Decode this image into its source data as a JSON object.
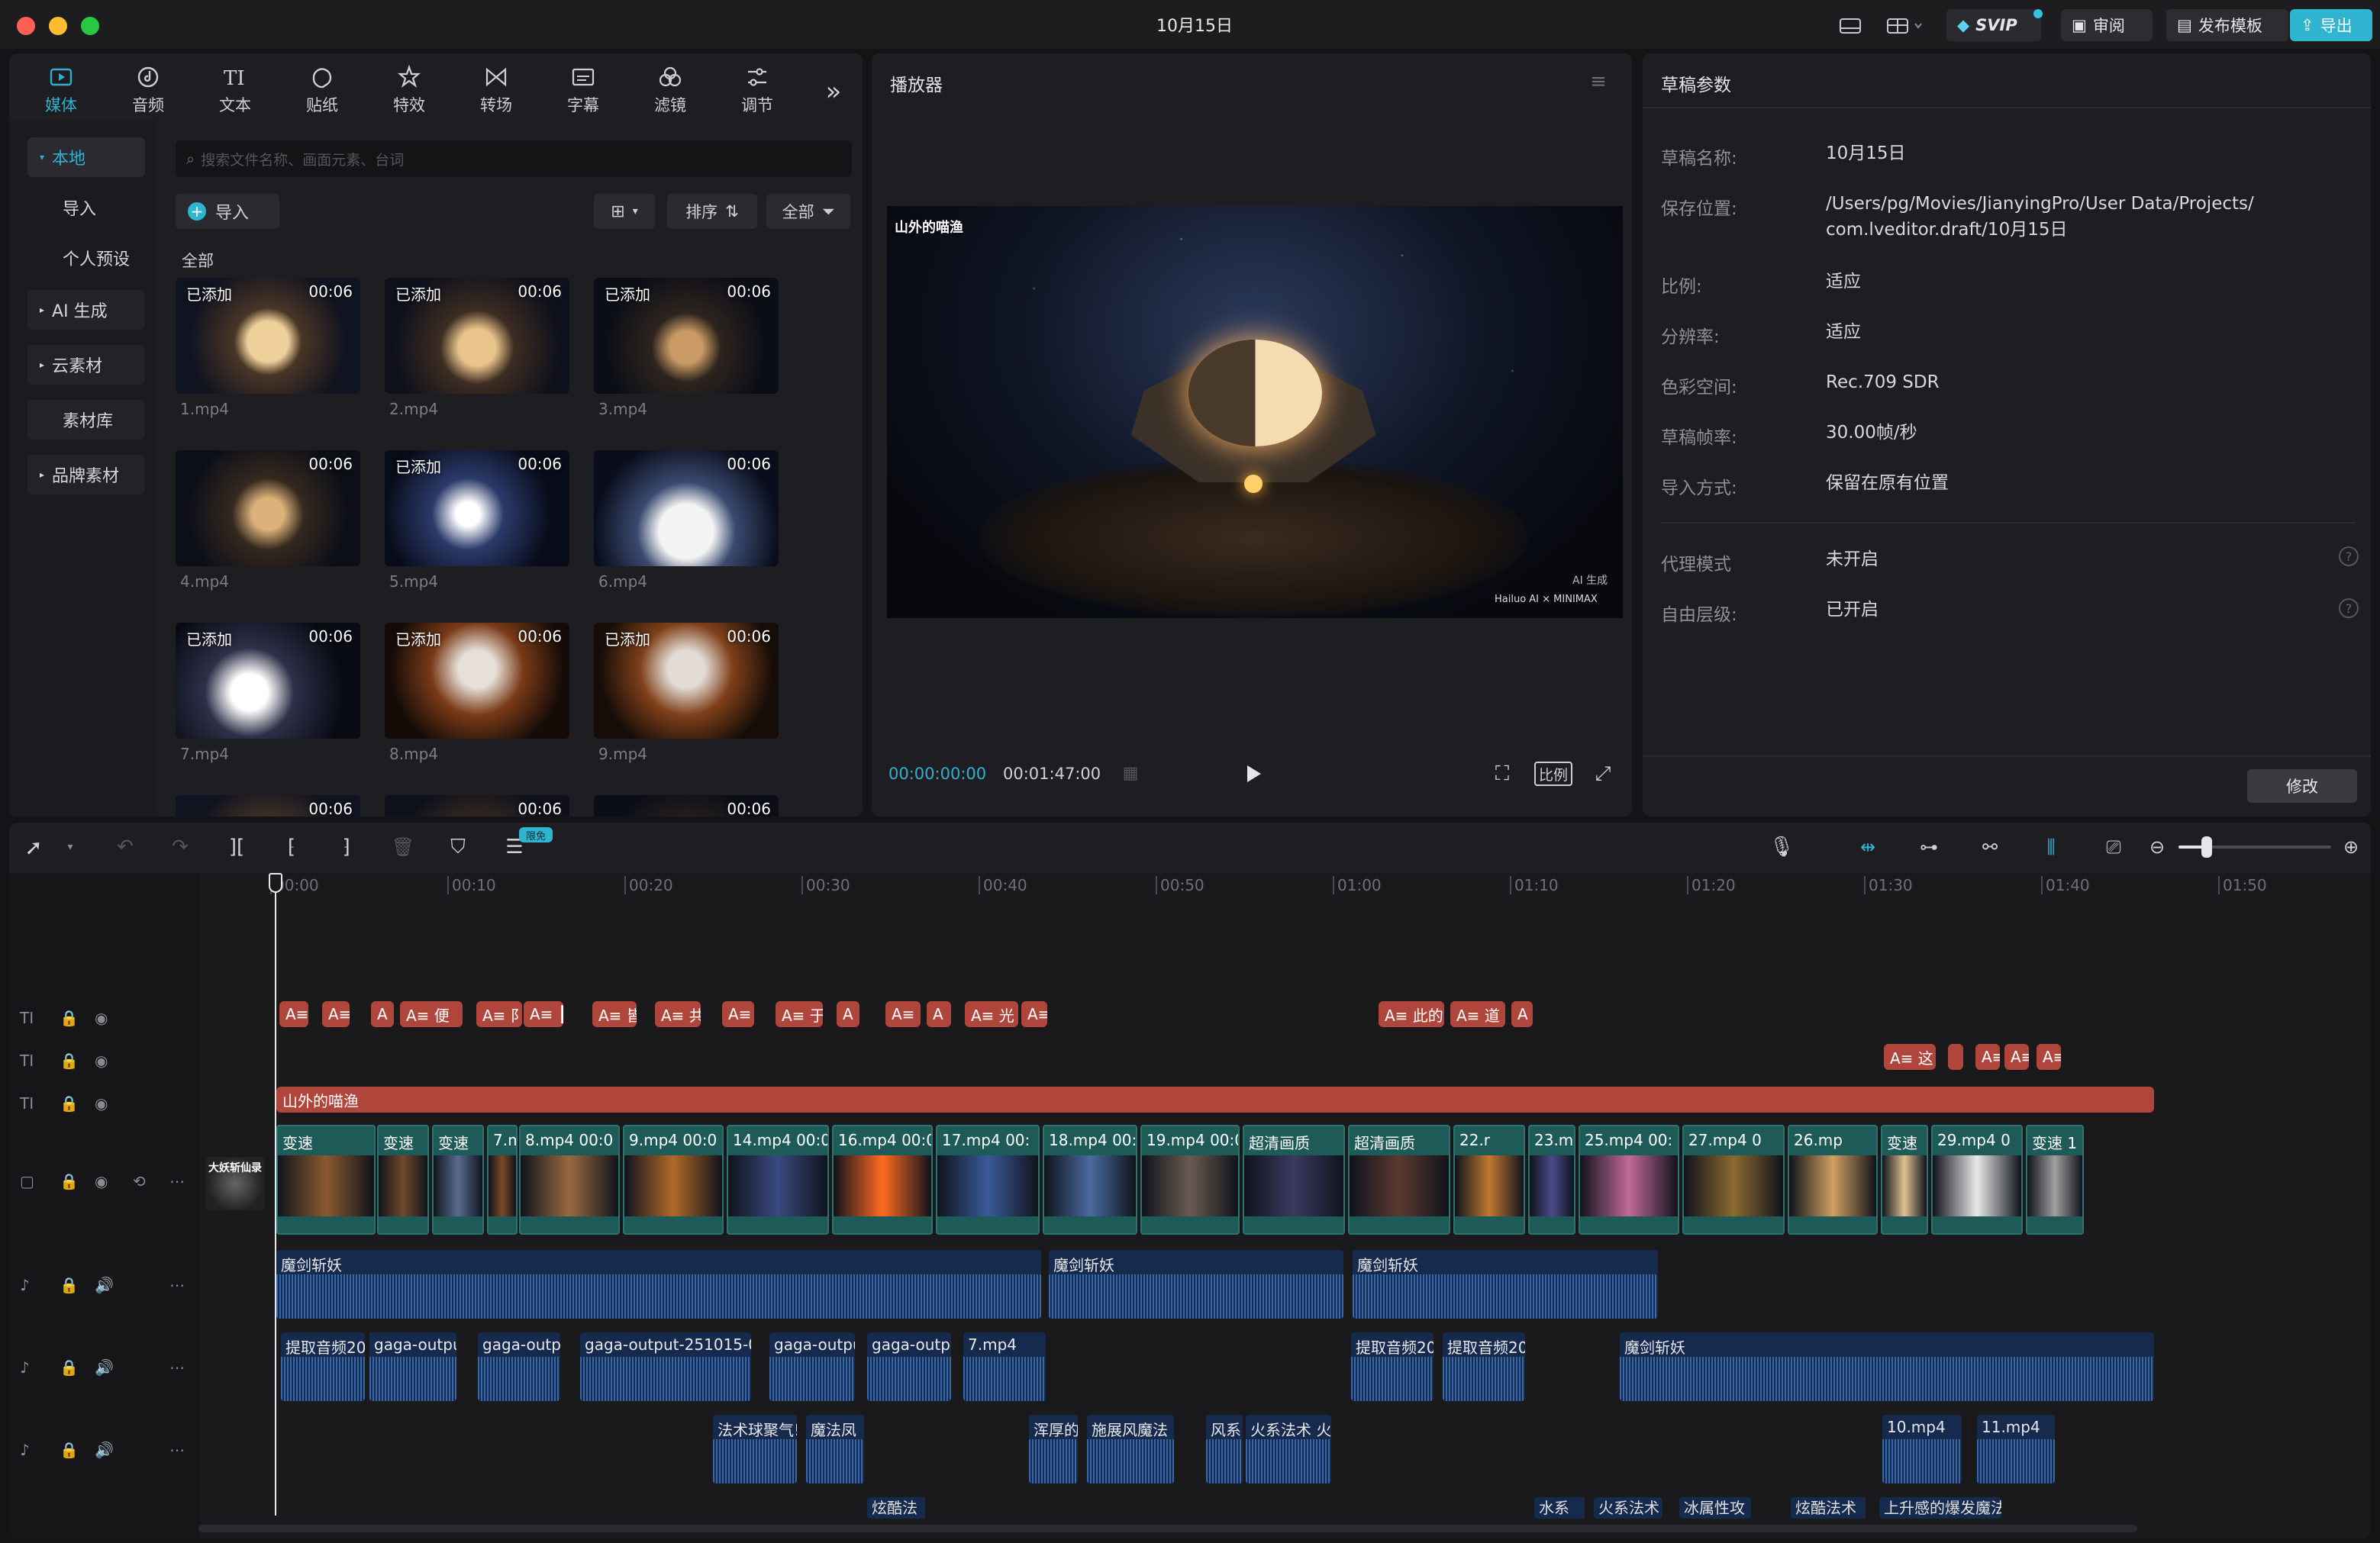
{
  "window": {
    "title": "10月15日"
  },
  "titlebar": {
    "svip": "SVIP",
    "review": "审阅",
    "publish_template": "发布模板",
    "export": "导出"
  },
  "tools": {
    "tabs": [
      {
        "label": "媒体",
        "icon": "media-icon"
      },
      {
        "label": "音频",
        "icon": "audio-icon"
      },
      {
        "label": "文本",
        "icon": "text-icon"
      },
      {
        "label": "贴纸",
        "icon": "sticker-icon"
      },
      {
        "label": "特效",
        "icon": "effects-icon"
      },
      {
        "label": "转场",
        "icon": "transition-icon"
      },
      {
        "label": "字幕",
        "icon": "subtitle-icon"
      },
      {
        "label": "滤镜",
        "icon": "filter-icon"
      },
      {
        "label": "调节",
        "icon": "adjust-icon"
      }
    ]
  },
  "media": {
    "sidebar": [
      "本地",
      "导入",
      "个人预设",
      "AI 生成",
      "云素材",
      "素材库",
      "品牌素材"
    ],
    "search_placeholder": "搜索文件名称、画面元素、台词",
    "import_label": "导入",
    "sort_label": "排序",
    "filter_label": "全部",
    "section_label": "全部",
    "items": [
      {
        "badge": "已添加",
        "duration": "00:06",
        "name": "1.mp4"
      },
      {
        "badge": "已添加",
        "duration": "00:06",
        "name": "2.mp4"
      },
      {
        "badge": "已添加",
        "duration": "00:06",
        "name": "3.mp4"
      },
      {
        "badge": "",
        "duration": "00:06",
        "name": "4.mp4"
      },
      {
        "badge": "已添加",
        "duration": "00:06",
        "name": "5.mp4"
      },
      {
        "badge": "",
        "duration": "00:06",
        "name": "6.mp4"
      },
      {
        "badge": "已添加",
        "duration": "00:06",
        "name": "7.mp4"
      },
      {
        "badge": "已添加",
        "duration": "00:06",
        "name": "8.mp4"
      },
      {
        "badge": "已添加",
        "duration": "00:06",
        "name": "9.mp4"
      },
      {
        "badge": "",
        "duration": "00:06",
        "name": ""
      },
      {
        "badge": "",
        "duration": "00:06",
        "name": ""
      },
      {
        "badge": "",
        "duration": "00:06",
        "name": ""
      }
    ]
  },
  "player": {
    "title": "播放器",
    "current_time": "00:00:00:00",
    "total_time": "00:01:47:00",
    "ratio_label": "比例",
    "video_caption": "山外的喵渔",
    "watermark_ai": "AI 生成",
    "watermark_brand": "Hailuo AI × MINIMAX"
  },
  "draft": {
    "title": "草稿参数",
    "rows": [
      {
        "label": "草稿名称:",
        "value": "10月15日"
      },
      {
        "label": "保存位置:",
        "value": "/Users/pg/Movies/JianyingPro/User Data/Projects/",
        "value2": "com.lveditor.draft/10月15日"
      },
      {
        "label": "比例:",
        "value": "适应"
      },
      {
        "label": "分辨率:",
        "value": "适应"
      },
      {
        "label": "色彩空间:",
        "value": "Rec.709 SDR"
      },
      {
        "label": "草稿帧率:",
        "value": "30.00帧/秒"
      },
      {
        "label": "导入方式:",
        "value": "保留在原有位置"
      }
    ],
    "rows2": [
      {
        "label": "代理模式",
        "value": "未开启"
      },
      {
        "label": "自由层级:",
        "value": "已开启"
      }
    ],
    "modify_label": "修改"
  },
  "timeline": {
    "free_badge": "限免",
    "ruler": [
      "00:00",
      "00:10",
      "00:20",
      "00:30",
      "00:40",
      "00:50",
      "01:00",
      "01:10",
      "01:20",
      "01:30",
      "01:40",
      "01:50"
    ],
    "cover_label": "大妖斩仙录",
    "text_track1": [
      "A≡",
      "A≡",
      "A",
      "A≡ 便",
      "A≡ 阝",
      "A≡ ┠",
      "A≡ 皆",
      "A≡ 共",
      "A≡",
      "A≡ 于",
      "A",
      "A≡",
      "A",
      "A≡ 光",
      "A≡",
      "A≡ 此的",
      "A≡ 道",
      "A"
    ],
    "text_track2": [
      "A≡ 这",
      "",
      "A≡",
      "A≡",
      "A≡"
    ],
    "text_track3": "山外的喵渔",
    "video_clips": [
      "变速",
      "变速",
      "变速",
      "7.mp4 00:0",
      "8.mp4 00:0",
      "9.mp4 00:0",
      "14.mp4 00:0",
      "16.mp4 00:0",
      "17.mp4 00:",
      "18.mp4 00:0",
      "19.mp4 00:0",
      "超清画质",
      "超清画质",
      "22.r",
      "23.mp4 00:",
      "25.mp4 00:",
      "27.mp4 0",
      "26.mp",
      "变速",
      "29.mp4 0",
      "变速 1"
    ],
    "music_clips": [
      "魔剑斩妖",
      "魔剑斩妖",
      "魔剑斩妖"
    ],
    "audio2_clips": [
      "提取音频20",
      "gaga-outpu",
      "gaga-outpu",
      "gaga-output-251015-0",
      "gaga-outpu",
      "gaga-outpu",
      "7.mp4",
      "提取音频20",
      "提取音频20",
      "魔剑斩妖"
    ],
    "audio3_clips": [
      "法术球聚气!",
      "魔法凤",
      "浑厚的",
      "施展风魔法",
      "风系",
      "火系法术 火",
      "10.mp4",
      "11.mp4"
    ],
    "audio4_clips": [
      "炫酷法",
      "水系",
      "火系法术",
      "冰属性攻",
      "炫酷法术",
      "上升感的爆发魔法"
    ]
  }
}
